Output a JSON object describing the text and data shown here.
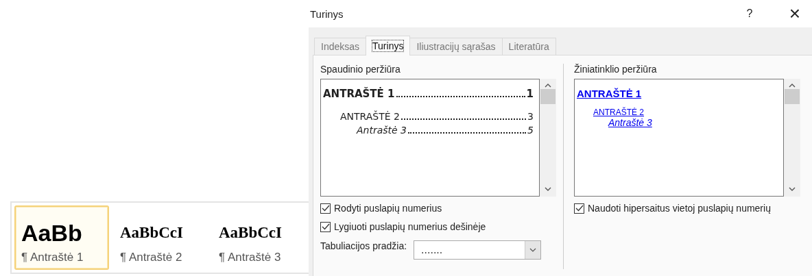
{
  "style_gallery": {
    "items": [
      {
        "sample": "AaBb",
        "label": "¶ Antraštė 1",
        "kind": "sans",
        "selected": true
      },
      {
        "sample": "AaBbCcI",
        "label": "¶ Antraštė 2",
        "kind": "serif",
        "selected": false
      },
      {
        "sample": "AaBbCcI",
        "label": "¶ Antraštė 3",
        "kind": "serif",
        "selected": false
      }
    ]
  },
  "window": {
    "title": "Turinys",
    "help": "?",
    "close": "×"
  },
  "tabs": [
    {
      "label": "Indeksas",
      "selected": false
    },
    {
      "label": "Turinys",
      "selected": true
    },
    {
      "label": "Iliustracijų sąrašas",
      "selected": false
    },
    {
      "label": "Literatūra",
      "selected": false
    }
  ],
  "print_preview": {
    "label": "Spaudinio peržiūra",
    "entries": [
      {
        "text": "ANTRAŠTĖ 1",
        "page": "1",
        "children": [
          {
            "text": "ANTRAŠTĖ 2",
            "page": "3",
            "children": [
              {
                "text": "Antraštė 3",
                "page": "5"
              }
            ]
          }
        ]
      }
    ]
  },
  "print_options": [
    {
      "label": "Rodyti puslapių numerius",
      "checked": true
    },
    {
      "label": "Lygiuoti puslapių numerius dešinėje",
      "checked": true
    }
  ],
  "tab_leader": {
    "label": "Tabuliacijos pradžia:",
    "value": "......."
  },
  "web_preview": {
    "label": "Žiniatinklio peržiūra",
    "entries": [
      {
        "text": "ANTRAŠTĖ 1",
        "children": [
          {
            "text": "ANTRAŠTĖ 2",
            "children": [
              {
                "text": "Antraštė 3"
              }
            ]
          }
        ]
      }
    ]
  },
  "web_options": [
    {
      "label": "Naudoti hipersaitus vietoj puslapių numerių",
      "checked": true
    }
  ]
}
